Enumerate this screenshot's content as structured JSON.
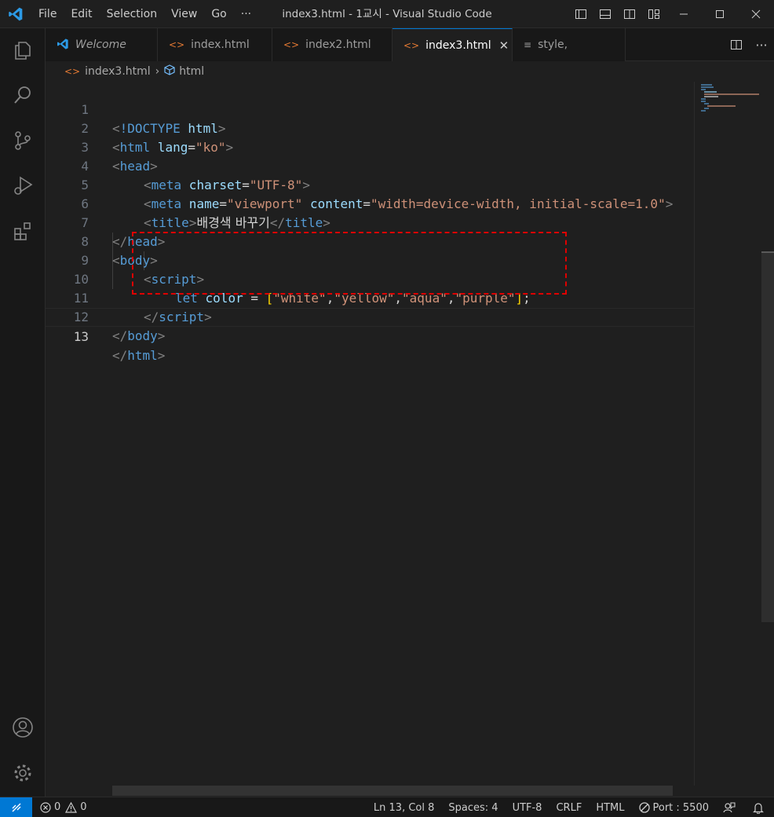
{
  "window": {
    "title": "index3.html - 1교시 - Visual Studio Code"
  },
  "menu": [
    "File",
    "Edit",
    "Selection",
    "View",
    "Go",
    "···"
  ],
  "tabs": [
    {
      "label": "Welcome",
      "icon": "vscode-logo-icon",
      "italic": true,
      "active": false
    },
    {
      "label": "index.html",
      "icon": "html-file-icon",
      "active": false
    },
    {
      "label": "index2.html",
      "icon": "html-file-icon",
      "active": false
    },
    {
      "label": "index3.html",
      "icon": "html-file-icon",
      "active": true
    },
    {
      "label": "style,",
      "icon": "css-file-icon",
      "active": false
    }
  ],
  "breadcrumb": {
    "file": "index3.html",
    "symbol": "html"
  },
  "editor": {
    "current_line": 13,
    "line_numbers": [
      "1",
      "2",
      "3",
      "4",
      "5",
      "6",
      "7",
      "8",
      "9",
      "10",
      "11",
      "12",
      "13"
    ],
    "tokens": {
      "l1": [
        "<",
        "!DOCTYPE",
        " html",
        ">"
      ],
      "l2": [
        "<",
        "html",
        " lang",
        "=",
        "\"ko\"",
        ">"
      ],
      "l3": [
        "<",
        "head",
        ">"
      ],
      "l4": [
        "<",
        "meta",
        " charset",
        "=",
        "\"UTF-8\"",
        ">"
      ],
      "l5": [
        "<",
        "meta",
        " name",
        "=",
        "\"viewport\"",
        " content",
        "=",
        "\"width=device-width, initial-scale=1.0\"",
        ">"
      ],
      "l6": [
        "<",
        "title",
        ">",
        "배경색 바꾸기",
        "</",
        "title",
        ">"
      ],
      "l7": [
        "</",
        "head",
        ">"
      ],
      "l8": [
        "<",
        "body",
        ">"
      ],
      "l9": [
        "<",
        "script",
        ">"
      ],
      "l10": [
        "let",
        " color",
        " = ",
        "[",
        "\"white\"",
        ",",
        "\"yellow\"",
        ",",
        "\"aqua\"",
        ",",
        "\"purple\"",
        "]",
        ";"
      ],
      "l11": [
        "</",
        "script",
        ">"
      ],
      "l12": [
        "</",
        "body",
        ">"
      ],
      "l13": [
        "</",
        "html",
        ">"
      ]
    }
  },
  "status": {
    "errors": "0",
    "warnings": "0",
    "position": "Ln 13, Col 8",
    "spaces": "Spaces: 4",
    "encoding": "UTF-8",
    "eol": "CRLF",
    "language": "HTML",
    "port": "Port : 5500"
  },
  "colors": {
    "accent": "#0078d4",
    "highlight_box": "#e00000",
    "tag": "#569cd6",
    "attribute": "#9cdcfe",
    "string": "#ce9178"
  }
}
